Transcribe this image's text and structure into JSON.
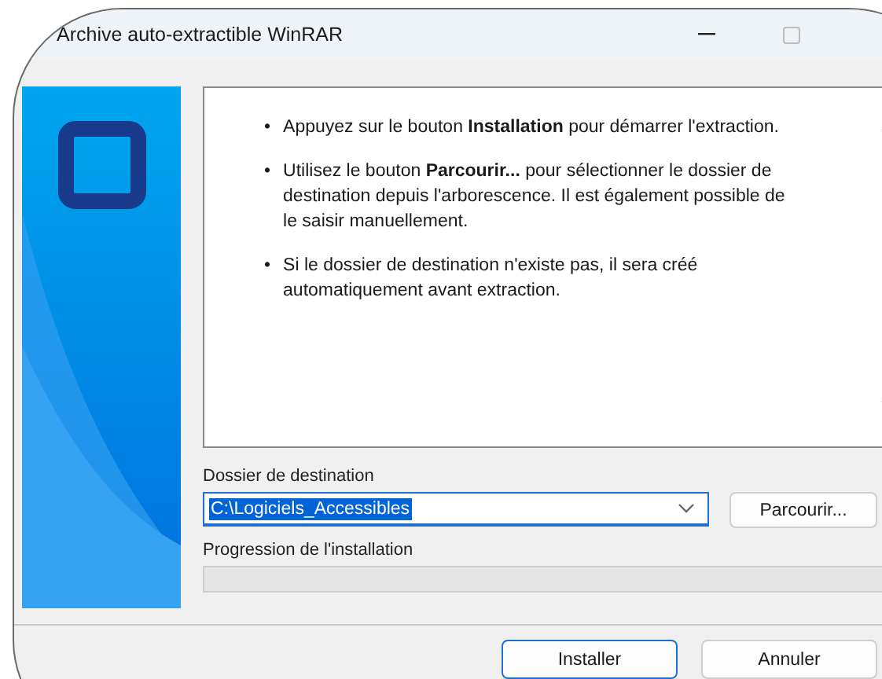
{
  "window": {
    "title": "Archive auto-extractible WinRAR"
  },
  "instructions": [
    {
      "bullet": "•",
      "text": "Appuyez sur le bouton **Installation** pour démarrer l'extraction."
    },
    {
      "bullet": "•",
      "text": "Utilisez le bouton **Parcourir...** pour sélectionner le dossier de destination depuis l'arborescence. Il est également possible de le saisir manuellement."
    },
    {
      "bullet": "•",
      "text": "Si le dossier de destination n'existe pas, il sera créé automatiquement avant extraction."
    }
  ],
  "destination": {
    "label": "Dossier de destination",
    "value": "C:\\Logiciels_Accessibles",
    "value_selected": true,
    "browse_button": "Parcourir..."
  },
  "progress": {
    "label": "Progression de l'installation",
    "level": 0
  },
  "buttons": [
    {
      "label": "Installer",
      "default": true
    },
    {
      "label": "Annuler",
      "default": false
    }
  ]
}
